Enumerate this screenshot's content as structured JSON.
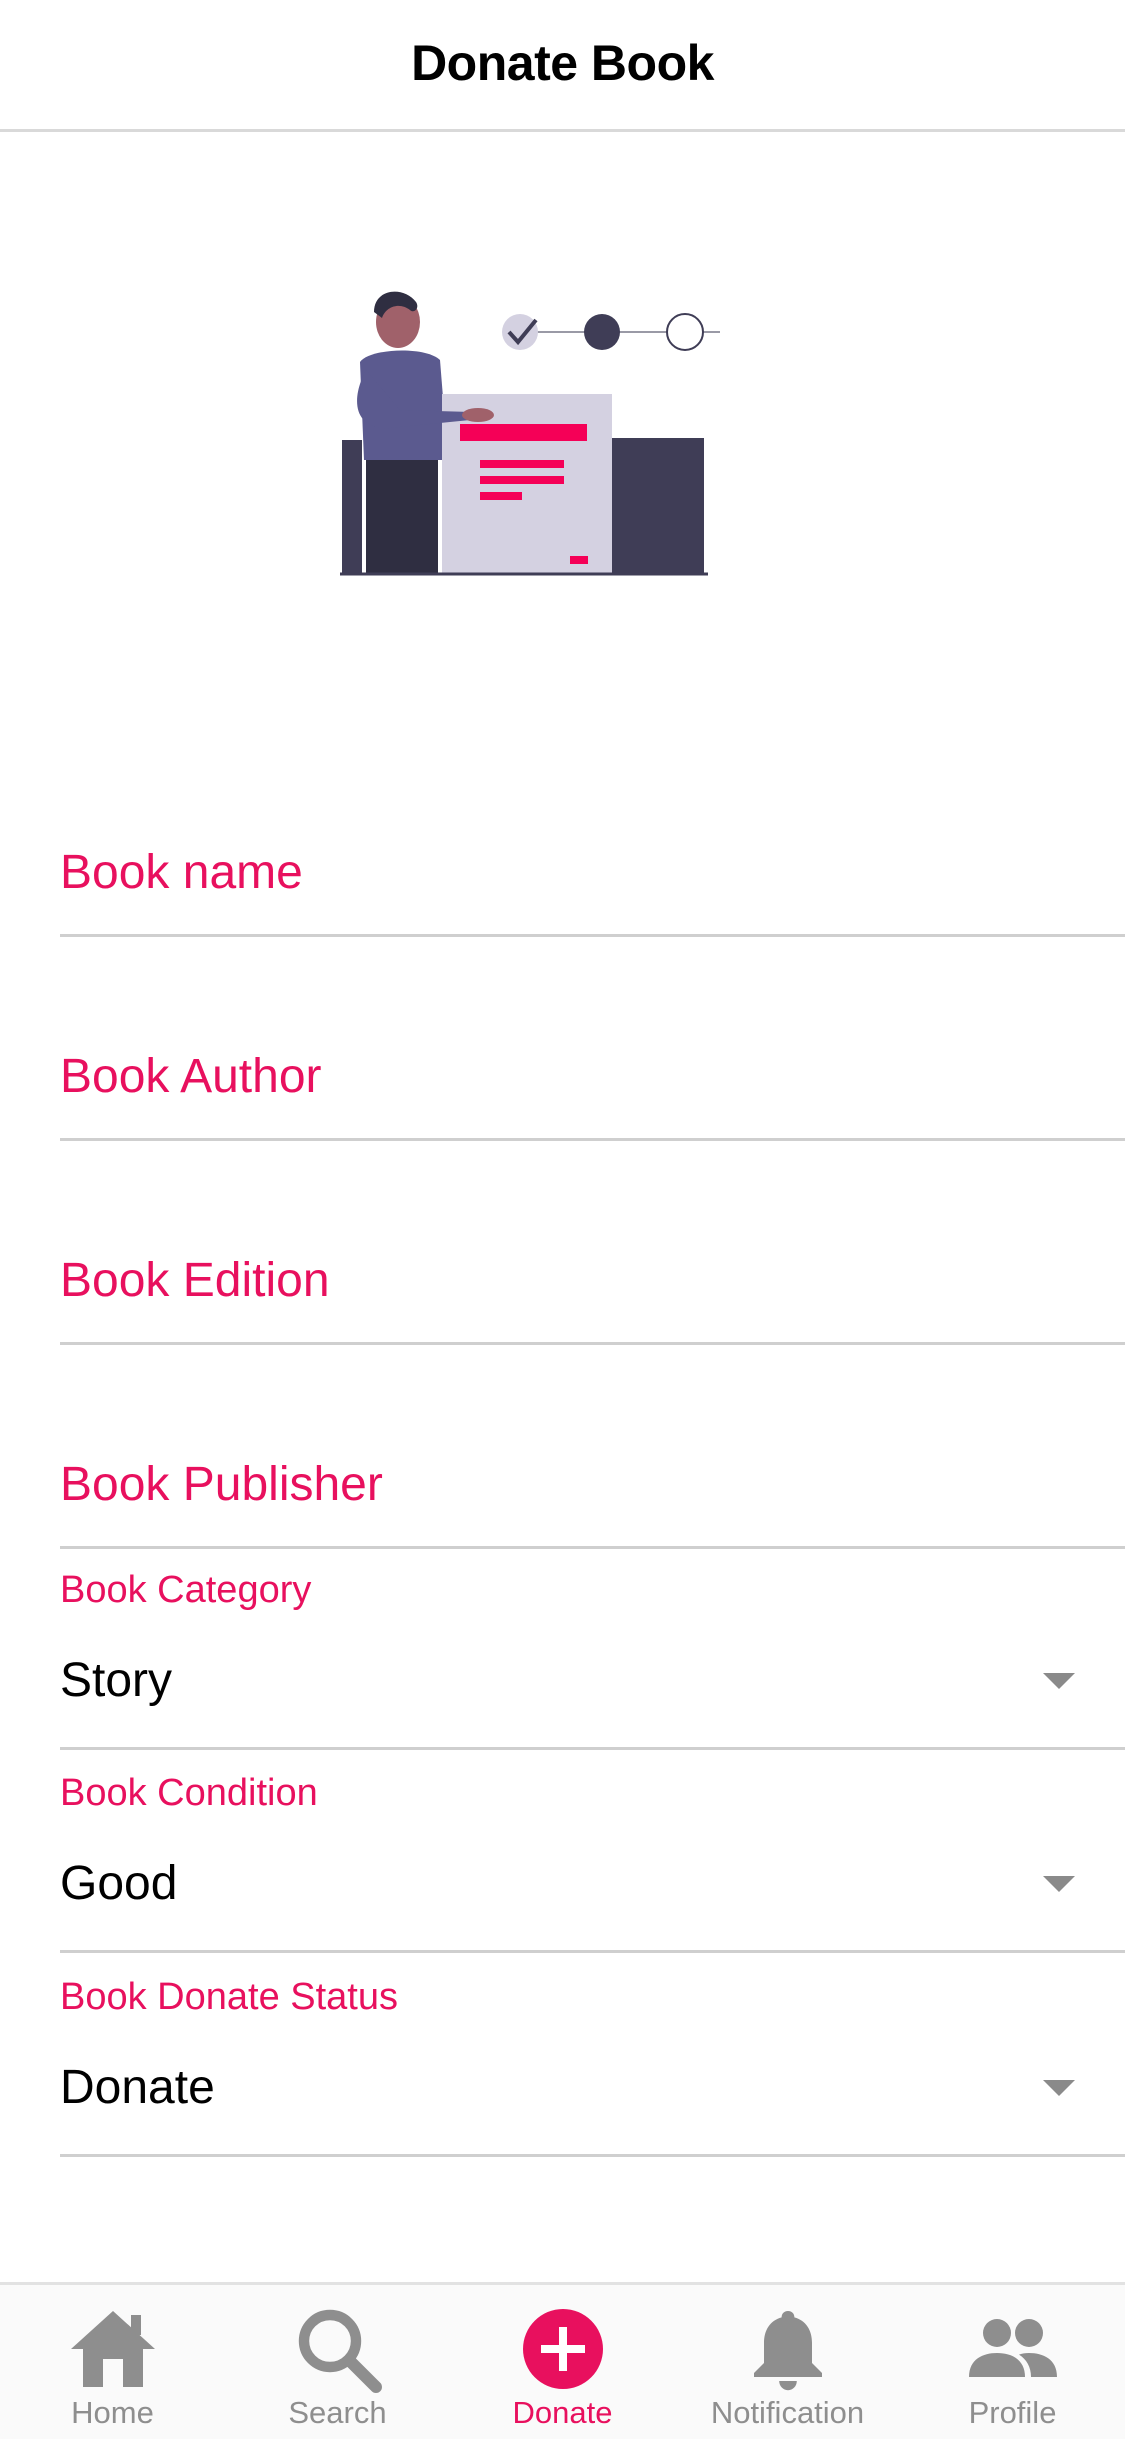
{
  "header": {
    "title": "Donate Book"
  },
  "form": {
    "book_name_label": "Book name",
    "book_author_label": "Book Author",
    "book_edition_label": "Book Edition",
    "book_publisher_label": "Book Publisher",
    "category": {
      "label": "Book Category",
      "value": "Story"
    },
    "condition": {
      "label": "Book Condition",
      "value": "Good"
    },
    "donate_status": {
      "label": "Book Donate Status",
      "value": "Donate"
    }
  },
  "bottom_nav": {
    "items": [
      {
        "label": "Home",
        "icon": "home-icon",
        "active": false
      },
      {
        "label": "Search",
        "icon": "search-icon",
        "active": false
      },
      {
        "label": "Donate",
        "icon": "add-circle-icon",
        "active": true
      },
      {
        "label": "Notification",
        "icon": "bell-icon",
        "active": false
      },
      {
        "label": "Profile",
        "icon": "people-icon",
        "active": false
      }
    ]
  },
  "colors": {
    "accent": "#e8105e",
    "inactive": "#8e8e8e",
    "divider": "#cfcfcf"
  }
}
